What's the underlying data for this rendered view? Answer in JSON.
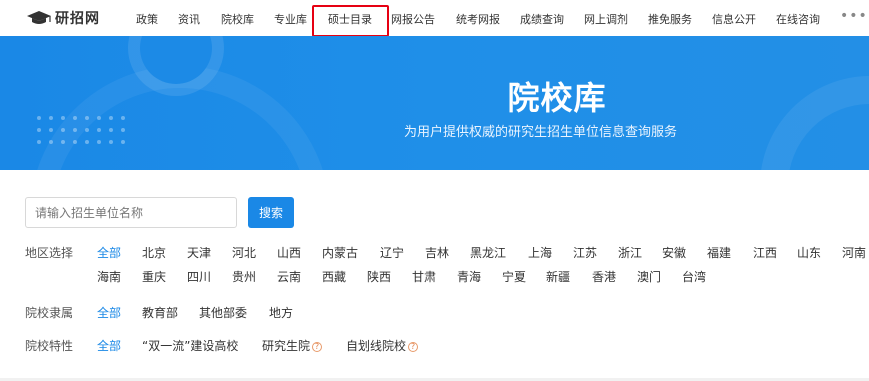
{
  "logo": {
    "text": "研招网",
    "icon": "graduation-cap-icon"
  },
  "nav": {
    "items": [
      "政策",
      "资讯",
      "院校库",
      "专业库",
      "硕士目录",
      "网报公告",
      "统考网报",
      "成绩查询",
      "网上调剂",
      "推免服务",
      "信息公开",
      "在线咨询"
    ],
    "more": "•••",
    "highlight_color": "#e60012"
  },
  "banner": {
    "title": "院校库",
    "subtitle": "为用户提供权威的研究生招生单位信息查询服务",
    "color": "#1a88e6"
  },
  "search": {
    "placeholder": "请输入招生单位名称",
    "value": "",
    "button": "搜索"
  },
  "filters": {
    "region": {
      "label": "地区选择",
      "options": [
        "全部",
        "北京",
        "天津",
        "河北",
        "山西",
        "内蒙古",
        "辽宁",
        "吉林",
        "黑龙江",
        "上海",
        "江苏",
        "浙江",
        "安徽",
        "福建",
        "江西",
        "山东",
        "河南",
        "海南",
        "重庆",
        "四川",
        "贵州",
        "云南",
        "西藏",
        "陕西",
        "甘肃",
        "青海",
        "宁夏",
        "新疆",
        "香港",
        "澳门",
        "台湾"
      ],
      "selected": "全部"
    },
    "affiliation": {
      "label": "院校隶属",
      "options": [
        "全部",
        "教育部",
        "其他部委",
        "地方"
      ],
      "selected": "全部"
    },
    "feature": {
      "label": "院校特性",
      "options": [
        "全部",
        "“双一流”建设高校",
        "研究生院",
        "自划线院校"
      ],
      "help": "?",
      "selected": "全部"
    }
  },
  "colors": {
    "accent": "#1a88e6",
    "text": "#333333",
    "label": "#555555"
  }
}
